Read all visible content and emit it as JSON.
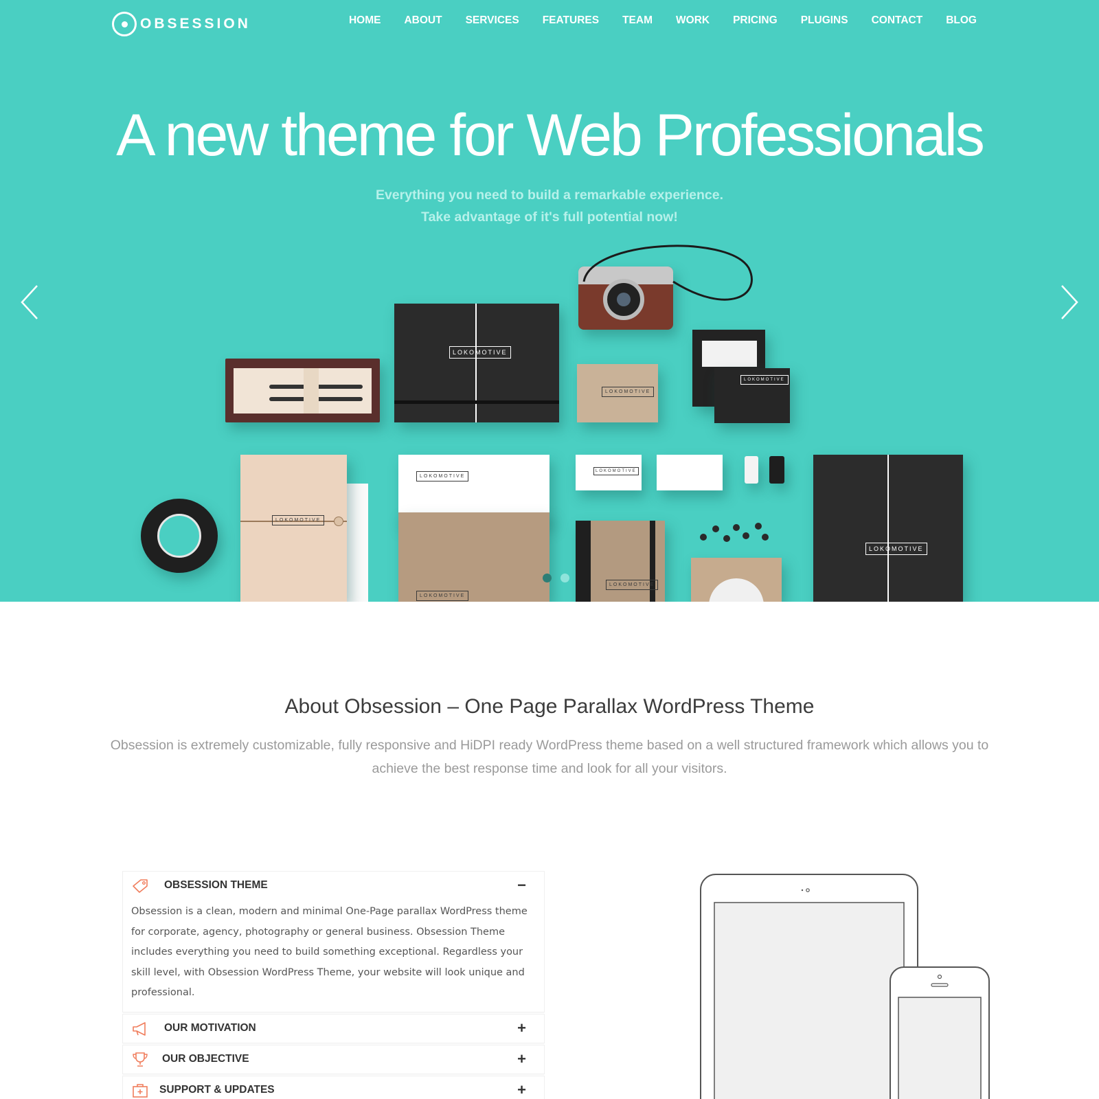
{
  "brand": {
    "name": "OBSESSION",
    "accent": "#4acfc2",
    "icon_accent": "#f07d5c"
  },
  "nav": {
    "items": [
      {
        "label": "HOME"
      },
      {
        "label": "ABOUT"
      },
      {
        "label": "SERVICES"
      },
      {
        "label": "FEATURES"
      },
      {
        "label": "TEAM"
      },
      {
        "label": "WORK"
      },
      {
        "label": "PRICING"
      },
      {
        "label": "PLUGINS"
      },
      {
        "label": "CONTACT"
      },
      {
        "label": "BLOG"
      }
    ]
  },
  "hero": {
    "title": "A new theme for Web Professionals",
    "subtitle_line1": "Everything you need to build a remarkable experience.",
    "subtitle_line2": "Take advantage of it's full potential now!",
    "prev_icon": "chevron-left-icon",
    "next_icon": "chevron-right-icon",
    "slides_total": 2,
    "active_slide": 1,
    "brand_tag": "LOKOMOTIVE"
  },
  "about": {
    "title": "About Obsession – One Page Parallax WordPress Theme",
    "text": "Obsession is extremely customizable, fully responsive and HiDPI ready WordPress theme based on a well structured framework which allows you to achieve the best response time and look for all your visitors."
  },
  "accordion": {
    "items": [
      {
        "title": "OBSESSION THEME",
        "icon": "tag-icon",
        "toggle": "−",
        "open": true,
        "body": "Obsession is a clean, modern and minimal One-Page parallax WordPress theme for corporate, agency, photography or general business. Obsession Theme includes everything you need to build something exceptional. Regardless your skill level, with Obsession WordPress Theme, your website will look unique and professional."
      },
      {
        "title": "OUR MOTIVATION",
        "icon": "megaphone-icon",
        "toggle": "+",
        "open": false
      },
      {
        "title": "OUR OBJECTIVE",
        "icon": "trophy-icon",
        "toggle": "+",
        "open": false
      },
      {
        "title": "SUPPORT & UPDATES",
        "icon": "first-aid-icon",
        "toggle": "+",
        "open": false
      }
    ]
  }
}
